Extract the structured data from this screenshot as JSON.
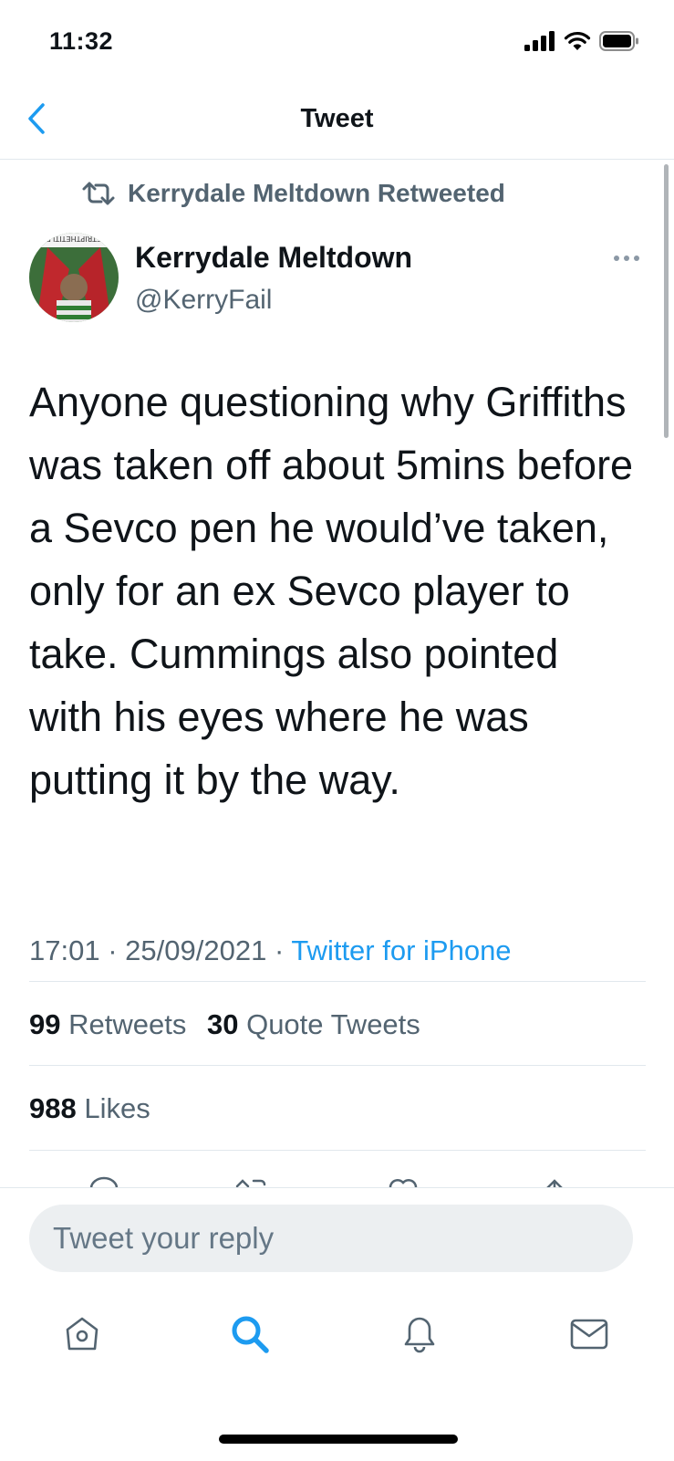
{
  "status_bar": {
    "time": "11:32"
  },
  "nav": {
    "title": "Tweet"
  },
  "retweet_banner": {
    "text": "Kerrydale Meltdown Retweeted"
  },
  "tweet": {
    "author_name": "Kerrydale Meltdown",
    "author_handle": "@KerryFail",
    "avatar_caption": "STRIPTHETITLE",
    "text": "Anyone questioning why Griffiths was taken off about 5mins before a Sevco pen he would’ve taken, only for an ex Sevco player to take. Cummings also pointed with his eyes where he was putting it by the way.",
    "time": "17:01",
    "separator": "·",
    "date": "25/09/2021",
    "source": "Twitter for iPhone"
  },
  "stats": {
    "retweets_count": "99",
    "retweets_label": "Retweets",
    "quotes_count": "30",
    "quotes_label": "Quote Tweets",
    "likes_count": "988",
    "likes_label": "Likes"
  },
  "reply": {
    "placeholder": "Tweet your reply"
  },
  "colors": {
    "accent": "#1d9bf0",
    "secondary_text": "#536471",
    "primary_text": "#0f1419"
  },
  "icons": [
    "back-chevron-icon",
    "retweet-icon",
    "more-icon",
    "home-icon",
    "search-icon",
    "notifications-bell-icon",
    "messages-mail-icon"
  ]
}
